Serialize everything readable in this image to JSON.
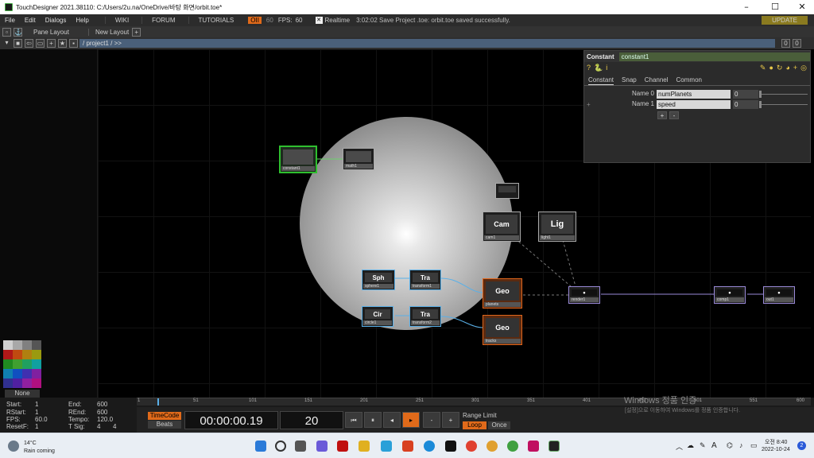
{
  "window": {
    "title": "TouchDesigner 2021.38110: C:/Users/2u.na/OneDrive/바탕 화면/orbit.toe*"
  },
  "menubar": {
    "items": [
      "File",
      "Edit",
      "Dialogs",
      "Help"
    ],
    "tabs": [
      "WIKI",
      "FORUM",
      "TUTORIALS"
    ],
    "oll": "OII",
    "fps_cap": "60",
    "fps_label": "FPS:",
    "fps_value": "60",
    "realtime": "Realtime",
    "status": "3:02:02 Save Project .toe: orbit.toe saved successfully.",
    "update": "UPDATE"
  },
  "toolbar": {
    "pane_layout": "Pane Layout",
    "new_layout": "New Layout",
    "add": "+"
  },
  "pathbar": {
    "path": "/ project1 / >>",
    "count1": "0",
    "count2": "0"
  },
  "nodes": {
    "constant1": "constant1",
    "math1": "math1",
    "null": "null",
    "cam": "Cam",
    "cam_label": "cam1",
    "lig": "Lig",
    "lig_label": "light1",
    "sph": "Sph",
    "sph_label": "sphere1",
    "tra1": "Tra",
    "tra1_label": "transform1",
    "geo1": "Geo",
    "geo1_label": "planets",
    "cir": "Cir",
    "cir_label": "circle1",
    "tra2": "Tra",
    "tra2_label": "transform2",
    "geo2": "Geo",
    "geo2_label": "tracks",
    "render": "render1",
    "comp1": "comp1",
    "out": "out1"
  },
  "param": {
    "type": "Constant",
    "name": "constant1",
    "tabs": [
      "Constant",
      "Snap",
      "Channel",
      "Common"
    ],
    "rows": [
      {
        "label": "Name 0",
        "value": "numPlanets",
        "num": "0"
      },
      {
        "label": "Name 1",
        "value": "speed",
        "num": "0"
      }
    ],
    "add": "+",
    "remove": "-",
    "plus_row": "+"
  },
  "palette": {
    "none_label": "None"
  },
  "info": {
    "start_l": "Start:",
    "start_v": "1",
    "rstart_l": "RStart:",
    "rstart_v": "1",
    "fps_l": "FPS:",
    "fps_v": "60.0",
    "resetf_l": "ResetF:",
    "resetf_v": "1",
    "end_l": "End:",
    "end_v": "600",
    "rend_l": "REnd:",
    "rend_v": "600",
    "tempo_l": "Tempo:",
    "tempo_v": "120.0",
    "tsig_l": "T Sig:",
    "tsig_v1": "4",
    "tsig_v2": "4"
  },
  "timeline": {
    "ticks": [
      "1",
      "51",
      "101",
      "151",
      "201",
      "251",
      "301",
      "351",
      "401",
      "451",
      "501",
      "551",
      "600"
    ]
  },
  "transport": {
    "timecode_btn": "TimeCode",
    "beats_btn": "Beats",
    "timecode": "00:00:00.19",
    "frame": "20",
    "range_limit": "Range Limit",
    "loop": "Loop",
    "once": "Once",
    "minus": "-",
    "plus": "+"
  },
  "watermark": {
    "line1": "Windows 정품 인증",
    "line2": "[설정]으로 이동하여 Windows를 정품 인증합니다."
  },
  "taskbar": {
    "weather_temp": "14°C",
    "weather_desc": "Rain coming",
    "time": "오전 8:40",
    "date": "2022-10-24",
    "lang": "A",
    "notif": "2"
  },
  "colors": {
    "accent_orange": "#e06a1a",
    "path_blue": "#4a607a",
    "select_green": "#2fbf2f"
  }
}
